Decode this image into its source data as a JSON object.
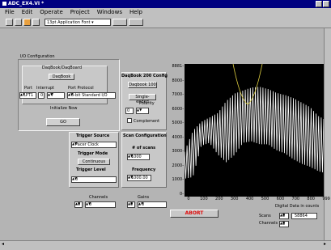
{
  "window": {
    "title": "ADC_EX4.VI *"
  },
  "menu": [
    "File",
    "Edit",
    "Operate",
    "Project",
    "Windows",
    "Help"
  ],
  "toolbar": {
    "font": "13pt Application Font"
  },
  "io": {
    "tab_label": "I/O Configuration",
    "daqbook_box_label": "DaqBook/DaqBoard",
    "daqbook_button": "DaqBook",
    "port_label": "Port",
    "interrupt_label": "Interrupt",
    "protocol_label": "Port Protocol",
    "port_value": "LPT1",
    "interrupt_value": "0",
    "interrupt_num": "7",
    "protocol_value": "8-bit Standard I/O",
    "init_label": "Initialize Now",
    "go_button": "GO"
  },
  "daqbook200": {
    "title": "DaqBook 200 Config",
    "model_button": "Daqbook 100",
    "mode_button": "Single-ended",
    "polarity_label": "Polarity",
    "polarity_value": "0",
    "complement_label": "Complement"
  },
  "trigger": {
    "source_label": "Trigger Source",
    "source_value": "Pacer Clock",
    "mode_label": "Trigger Mode",
    "mode_value": "Continuous",
    "level_label": "Trigger Level",
    "level_value": "0"
  },
  "scan": {
    "title": "Scan Configuration",
    "scans_label": "# of scans",
    "scans_value": "1000",
    "freq_label": "Frequency",
    "freq_value": "1000.00"
  },
  "channels": {
    "channels_label": "Channels",
    "gains_label": "Gains",
    "ch_index": "0",
    "ch_value": "0",
    "gain_index": "0",
    "gain_value": "0"
  },
  "chart": {
    "y_ticks": [
      "8881-",
      "8000-",
      "7000-",
      "6000-",
      "5000-",
      "4000-",
      "3000-",
      "2000-",
      "1000-",
      "0-"
    ],
    "x_ticks": [
      "0",
      "100",
      "200",
      "300",
      "400",
      "500",
      "600",
      "700",
      "800",
      "999"
    ],
    "xlabel": "Digital Data in counts",
    "trace_color": "#ffffff",
    "overlay_color": "#e0d040"
  },
  "abort_label": "ABORT",
  "readout": {
    "scans_label": "Scans",
    "channels_label": "Channels",
    "scans_index": "0",
    "scans_value": "58864",
    "channels_value": "0"
  },
  "chart_data": {
    "type": "line",
    "xlabel": "Digital Data in counts",
    "ylabel": "",
    "xlim": [
      0,
      999
    ],
    "ylim": [
      0,
      8881
    ],
    "series": [
      {
        "x": [
          0,
          60,
          120,
          180,
          240,
          300,
          360,
          420,
          480,
          540,
          600,
          660,
          720,
          780,
          840,
          900,
          960,
          999
        ],
        "upper": [
          3000,
          4400,
          5000,
          5300,
          5600,
          6400,
          6900,
          7100,
          7300,
          7350,
          7200,
          6950,
          6800,
          6600,
          6300,
          6000,
          5400,
          5200
        ],
        "lower": [
          1200,
          1300,
          3400,
          3600,
          2800,
          2300,
          2800,
          3600,
          3700,
          3500,
          3500,
          3100,
          2900,
          2500,
          2200,
          2000,
          1700,
          1600
        ]
      }
    ]
  }
}
